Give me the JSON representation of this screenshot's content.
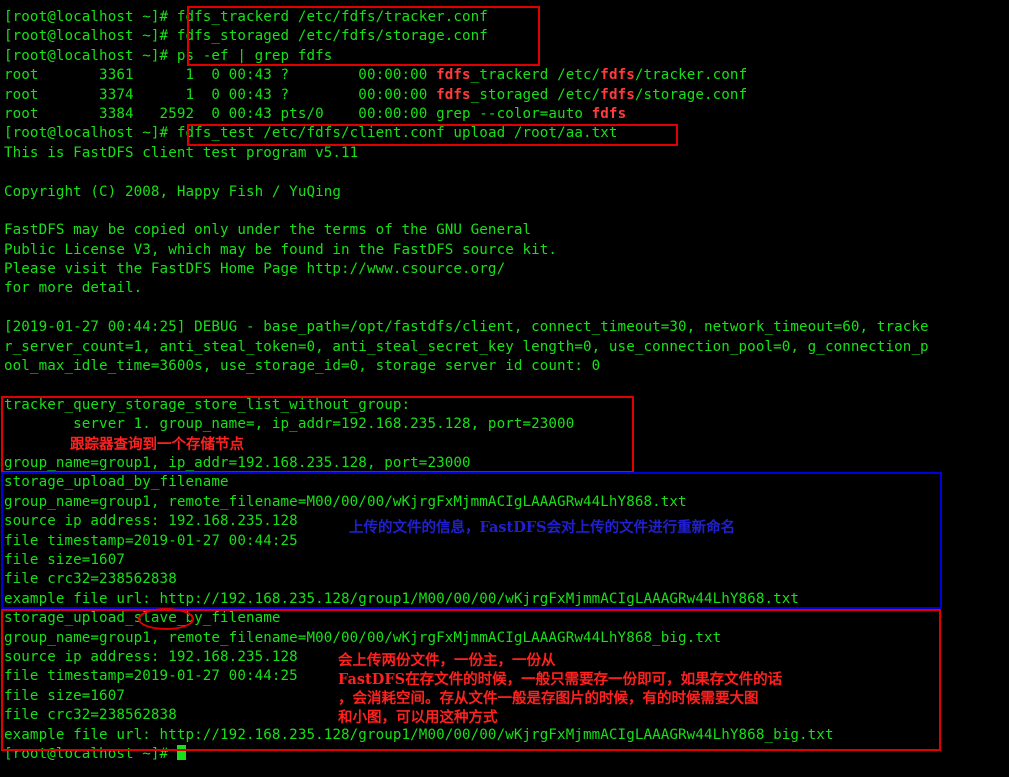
{
  "terminal": {
    "prompt": "[root@localhost ~]# ",
    "commands": {
      "trackerd": "fdfs_trackerd /etc/fdfs/tracker.conf",
      "storaged": "fdfs_storaged /etc/fdfs/storage.conf",
      "grep": "ps -ef | grep fdfs",
      "test": "fdfs_test /etc/fdfs/client.conf upload /root/aa.txt"
    },
    "ps": [
      {
        "pre": "root       3361      1  0 00:43 ?        00:00:00 ",
        "a": "fdfs",
        "b": "_trackerd /etc/",
        "c": "fdfs",
        "d": "/tracker.conf",
        "e": ""
      },
      {
        "pre": "root       3374      1  0 00:43 ?        00:00:00 ",
        "a": "fdfs",
        "b": "_storaged /etc/",
        "c": "fdfs",
        "d": "/storage.conf",
        "e": ""
      },
      {
        "pre": "root       3384   2592  0 00:43 pts/0    00:00:00 grep --color=auto ",
        "a": "",
        "b": "",
        "c": "",
        "d": "",
        "e": "fdfs"
      }
    ],
    "intro": [
      "This is FastDFS client test program v5.11",
      "",
      "Copyright (C) 2008, Happy Fish / YuQing",
      "",
      "FastDFS may be copied only under the terms of the GNU General",
      "Public License V3, which may be found in the FastDFS source kit.",
      "Please visit the FastDFS Home Page http://www.csource.org/",
      "for more detail.",
      "",
      "[2019-01-27 00:44:25] DEBUG - base_path=/opt/fastdfs/client, connect_timeout=30, network_timeout=60, tracke",
      "r_server_count=1, anti_steal_token=0, anti_steal_secret_key length=0, use_connection_pool=0, g_connection_p",
      "ool_max_idle_time=3600s, use_storage_id=0, storage server id count: 0",
      ""
    ],
    "query": [
      "tracker_query_storage_store_list_without_group:",
      "        server 1. group_name=, ip_addr=192.168.235.128, port=23000",
      "",
      "group_name=group1, ip_addr=192.168.235.128, port=23000"
    ],
    "upload": [
      "storage_upload_by_filename",
      "group_name=group1, remote_filename=M00/00/00/wKjrgFxMjmmACIgLAAAGRw44LhY868.txt",
      "source ip address: 192.168.235.128",
      "file timestamp=2019-01-27 00:44:25",
      "file size=1607",
      "file crc32=238562838",
      "example file url: http://192.168.235.128/group1/M00/00/00/wKjrgFxMjmmACIgLAAAGRw44LhY868.txt"
    ],
    "slave": [
      "storage_upload_slave_by_filename",
      "group_name=group1, remote_filename=M00/00/00/wKjrgFxMjmmACIgLAAAGRw44LhY868_big.txt",
      "source ip address: 192.168.235.128",
      "file timestamp=2019-01-27 00:44:25",
      "file size=1607",
      "file crc32=238562838",
      "example file url: http://192.168.235.128/group1/M00/00/00/wKjrgFxMjmmACIgLAAAGRw44LhY868_big.txt"
    ],
    "final_prompt": "[root@localhost ~]# "
  },
  "annotations": {
    "tracker_note": "跟踪器查询到一个存储节点",
    "upload_note": "上传的文件的信息，FastDFS会对上传的文件进行重新命名",
    "slave_note": [
      "会上传两份文件，一份主，一份从",
      "FastDFS在存文件的时候，一般只需要存一份即可，如果存文件的话",
      "，会消耗空间。存从文件一般是存图片的时候，有的时候需要大图",
      "和小图，可以用这种方式"
    ]
  },
  "colors": {
    "terminal_bg": "#000000",
    "terminal_text": "#18e018",
    "grep_highlight": "#ff3b3b",
    "annotation_red": "#e00000",
    "annotation_blue": "#0000d8"
  }
}
